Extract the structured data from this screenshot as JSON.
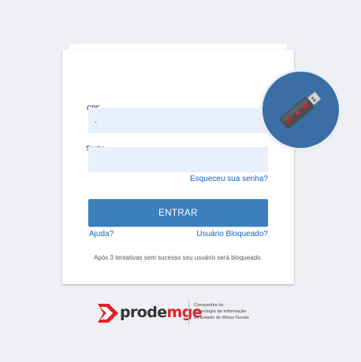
{
  "login": {
    "cpf": {
      "label": "CPF",
      "value": "."
    },
    "senha": {
      "label": "Senha",
      "value": ""
    },
    "forgot_password": "Esqueceu sua senha?",
    "enter_button": "ENTRAR",
    "help_link": "Ajuda?",
    "blocked_user_link": "Usuário Bloqueado?",
    "warning": "Após 3 tentativas sem sucesso seu usuário será bloqueado."
  },
  "token_badge": {
    "icon": "usb-token-icon",
    "color": "#3a6ea5"
  },
  "footer": {
    "logo_part1": "prode",
    "logo_part2": "mge",
    "description": [
      "Companhia de",
      "Tecnologia da Informação",
      "do Estado de Minas Gerais"
    ]
  },
  "colors": {
    "background": "#eff0f4",
    "button": "#3a80bc",
    "link": "#1565c0",
    "input_fill": "#e8f0fe",
    "brand_red": "#e32229"
  }
}
